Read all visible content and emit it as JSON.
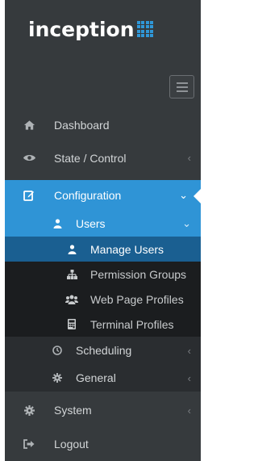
{
  "brand": {
    "name": "inception",
    "mark_color": "#2f97d8"
  },
  "toggle": {
    "icon": "hamburger-icon"
  },
  "menu": {
    "dashboard": {
      "label": "Dashboard",
      "icon": "home-icon"
    },
    "state_control": {
      "label": "State / Control",
      "icon": "eye-icon",
      "chevron": "‹"
    },
    "configuration": {
      "label": "Configuration",
      "icon": "edit-icon",
      "chevron": "⌄"
    },
    "users": {
      "label": "Users",
      "icon": "user-icon",
      "chevron": "⌄"
    },
    "manage_users": {
      "label": "Manage Users",
      "icon": "user-icon"
    },
    "permission_groups": {
      "label": "Permission Groups",
      "icon": "sitemap-icon"
    },
    "web_page_profiles": {
      "label": "Web Page Profiles",
      "icon": "users-icon"
    },
    "terminal_profiles": {
      "label": "Terminal Profiles",
      "icon": "calculator-icon"
    },
    "scheduling": {
      "label": "Scheduling",
      "icon": "clock-icon",
      "chevron": "‹"
    },
    "general": {
      "label": "General",
      "icon": "gear-icon",
      "chevron": "‹"
    },
    "system": {
      "label": "System",
      "icon": "gear-icon",
      "chevron": "‹"
    },
    "logout": {
      "label": "Logout",
      "icon": "sign-out-icon"
    }
  },
  "colors": {
    "sidebar_bg": "#363a3d",
    "accent": "#2f94d6",
    "current_item": "#1a5f91",
    "submenu_bg": "#1b1d1f"
  }
}
